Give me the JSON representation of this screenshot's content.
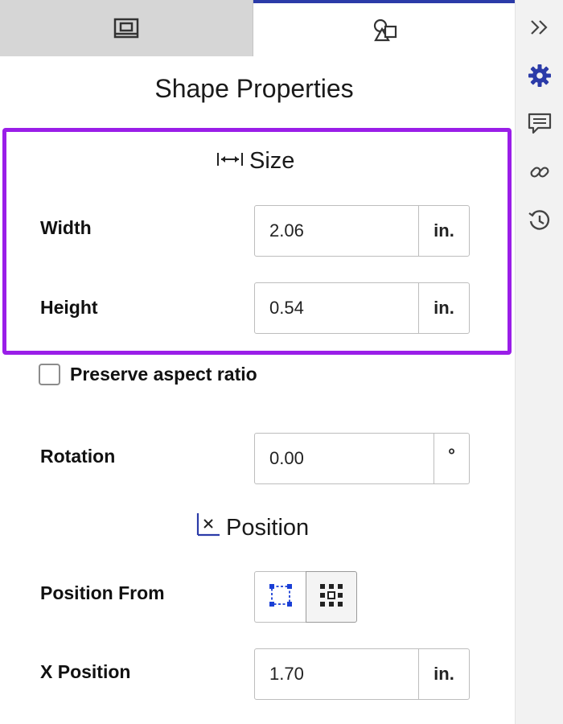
{
  "tabs": [
    {
      "name": "layout",
      "icon": "page-layout-icon",
      "active": false
    },
    {
      "name": "shape",
      "icon": "shapes-icon",
      "active": true
    }
  ],
  "rail": {
    "icons": [
      "expand-chevrons-icon",
      "gear-icon",
      "comments-icon",
      "link-icon",
      "history-icon"
    ],
    "accent": "#2b3ba8"
  },
  "panel": {
    "title": "Shape Properties"
  },
  "size": {
    "header": "Size",
    "highlight_color": "#9a1ee8",
    "width": {
      "label": "Width",
      "value": "2.06",
      "unit": "in."
    },
    "height": {
      "label": "Height",
      "value": "0.54",
      "unit": "in."
    }
  },
  "preserve_aspect": {
    "label": "Preserve aspect ratio",
    "checked": false
  },
  "rotation": {
    "label": "Rotation",
    "value": "0.00",
    "unit": "°"
  },
  "position": {
    "header": "Position",
    "from_label": "Position From",
    "from_options": [
      "bounding-box-icon",
      "center-grid-icon"
    ],
    "x": {
      "label": "X Position",
      "value": "1.70",
      "unit": "in."
    }
  }
}
